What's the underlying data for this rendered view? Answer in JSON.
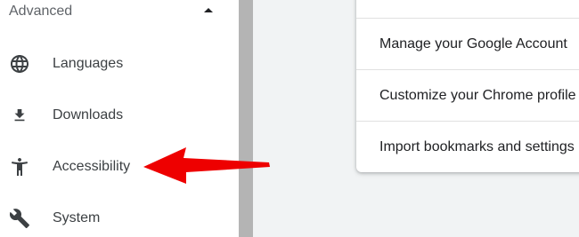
{
  "sidebar": {
    "section_label": "Advanced",
    "items": [
      {
        "label": "Languages",
        "icon": "globe-icon"
      },
      {
        "label": "Downloads",
        "icon": "download-icon"
      },
      {
        "label": "Accessibility",
        "icon": "accessibility-icon"
      },
      {
        "label": "System",
        "icon": "wrench-icon"
      }
    ]
  },
  "profile_card": {
    "items": [
      {
        "label": "Manage your Google Account"
      },
      {
        "label": "Customize your Chrome profile"
      },
      {
        "label": "Import bookmarks and settings"
      }
    ]
  },
  "annotation": {
    "arrow_color": "#ee0000"
  },
  "colors": {
    "background": "#f1f3f4",
    "sidebar": "#ffffff",
    "scrollbar": "#b4b4b4",
    "text": "#202124"
  }
}
